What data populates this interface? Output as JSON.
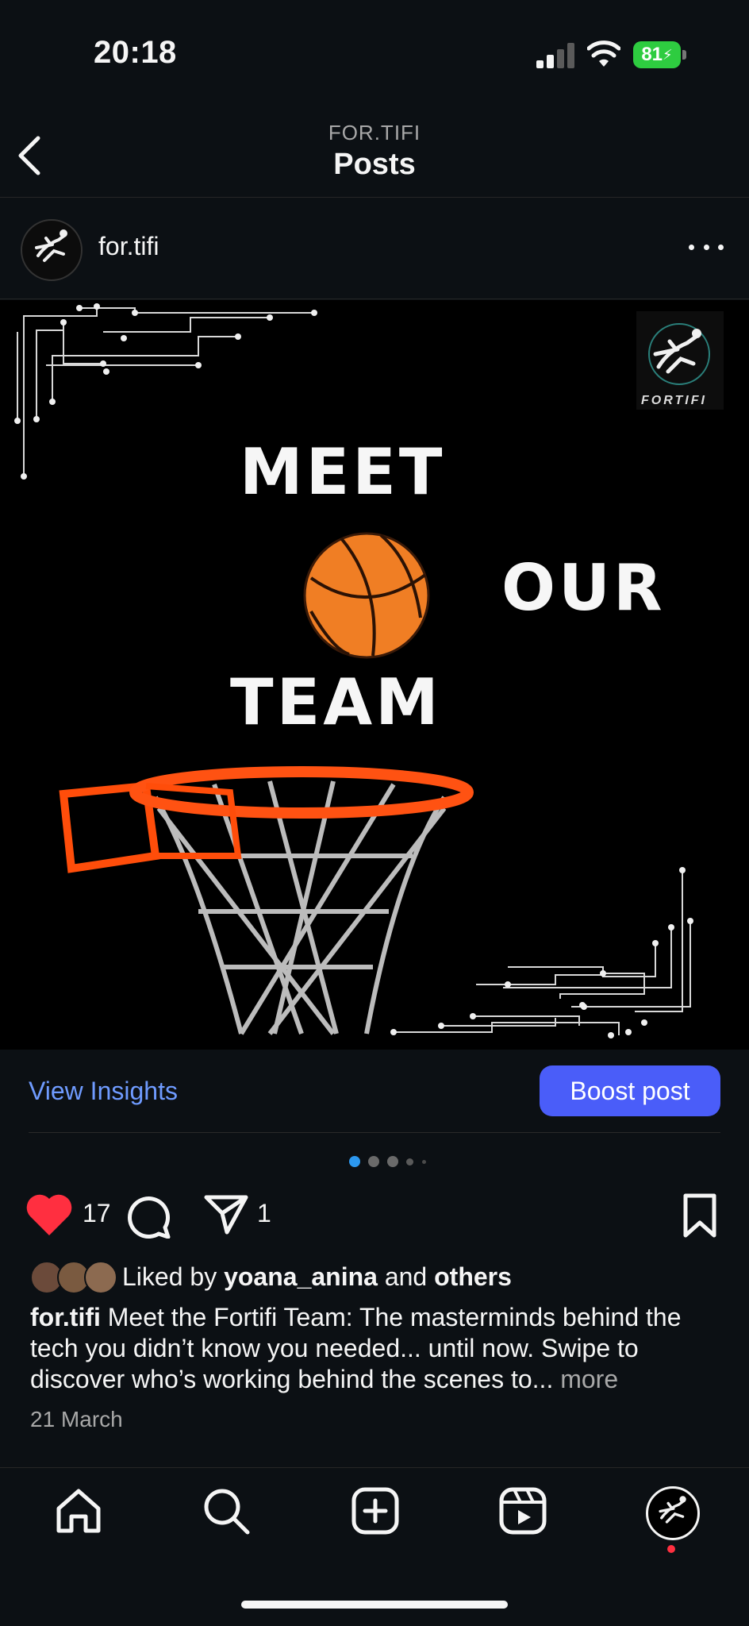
{
  "status_bar": {
    "time": "20:18",
    "battery": "81"
  },
  "header": {
    "account": "FOR.TIFI",
    "title": "Posts"
  },
  "post": {
    "username": "for.tifi",
    "image": {
      "logo_text": "FORTIFI",
      "line1": "MEET",
      "line2": "OUR",
      "line3": "TEAM"
    },
    "view_insights": "View Insights",
    "boost_label": "Boost post",
    "likes": "17",
    "shares": "1",
    "liked_by_prefix": "Liked by",
    "liked_by_user": "yoana_anina",
    "liked_by_and": "and",
    "liked_by_others": "others",
    "caption_user": "for.tifi",
    "caption_text": "Meet the Fortifi Team: The masterminds behind the tech you didn’t know you needed... until now. Swipe to discover who’s working behind the scenes to...",
    "caption_more": "more",
    "date": "21 March"
  },
  "icons": {
    "back": "chevron-left-icon",
    "like": "heart-icon",
    "comment": "comment-bubble-icon",
    "share": "paper-plane-icon",
    "save": "bookmark-icon"
  },
  "colors": {
    "accent_link": "#6f9bff",
    "boost_bg": "#4a5df9",
    "like": "#ff2f40",
    "active_dot": "#2c98f0"
  }
}
